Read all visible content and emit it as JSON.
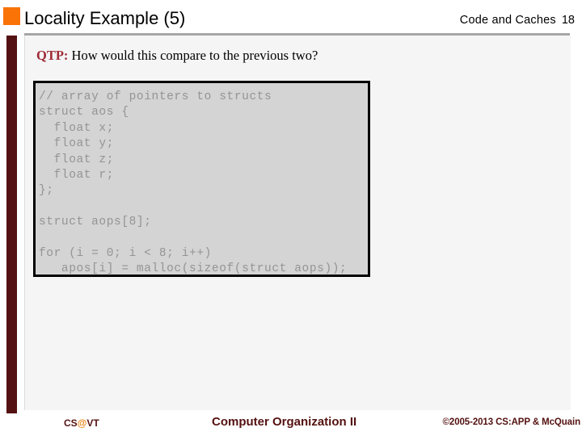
{
  "slide": {
    "title": "Locality Example (5)",
    "header_topic": "Code and Caches",
    "page_number": "18",
    "accent_orange": "#F97306",
    "accent_maroon": "#541111",
    "question_label": "QTP:",
    "question_text": " How would this compare to the previous two?",
    "code_lines": [
      "// array of pointers to structs",
      "struct aos {",
      "  float x;",
      "  float y;",
      "  float z;",
      "  float r;",
      "};",
      "",
      "struct aops[8];",
      "",
      "for (i = 0; i < 8; i++)",
      "   apos[i] = malloc(sizeof(struct aops));"
    ]
  },
  "footer": {
    "left_prefix": "CS",
    "left_at": "@",
    "left_suffix": "VT",
    "center": "Computer Organization II",
    "right": "©2005-2013 CS:APP & McQuain"
  }
}
